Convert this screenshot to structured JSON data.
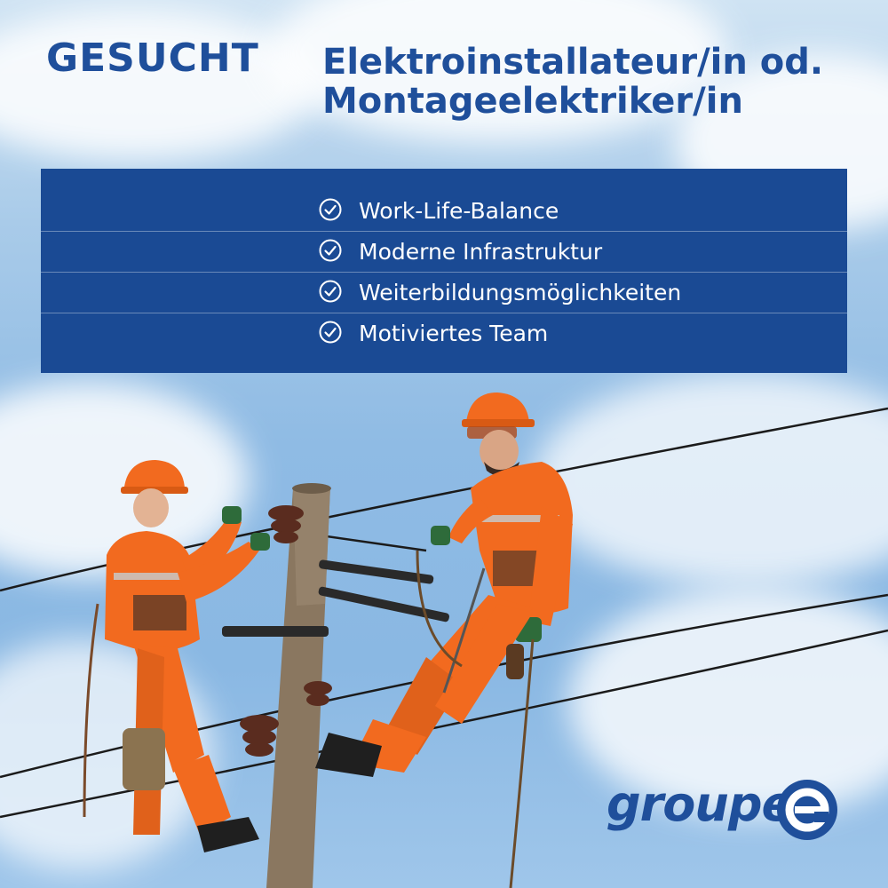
{
  "header": {
    "label": "GESUCHT",
    "job_title_line1": "Elektroinstallateur/in od.",
    "job_title_line2": "Montageelektriker/in"
  },
  "benefits": {
    "items": [
      {
        "label": "Work-Life-Balance",
        "icon": "check-circle-icon"
      },
      {
        "label": "Moderne Infrastruktur",
        "icon": "check-circle-icon"
      },
      {
        "label": "Weiterbildungsmöglichkeiten",
        "icon": "check-circle-icon"
      },
      {
        "label": "Motiviertes Team",
        "icon": "check-circle-icon"
      }
    ]
  },
  "logo": {
    "text": "groupe",
    "mark": "e-circle-icon"
  },
  "colors": {
    "brand_blue": "#1f4f9b",
    "panel_blue": "#1a4a94",
    "workwear_orange": "#f26a1f",
    "sky": "#8fbbe4"
  }
}
